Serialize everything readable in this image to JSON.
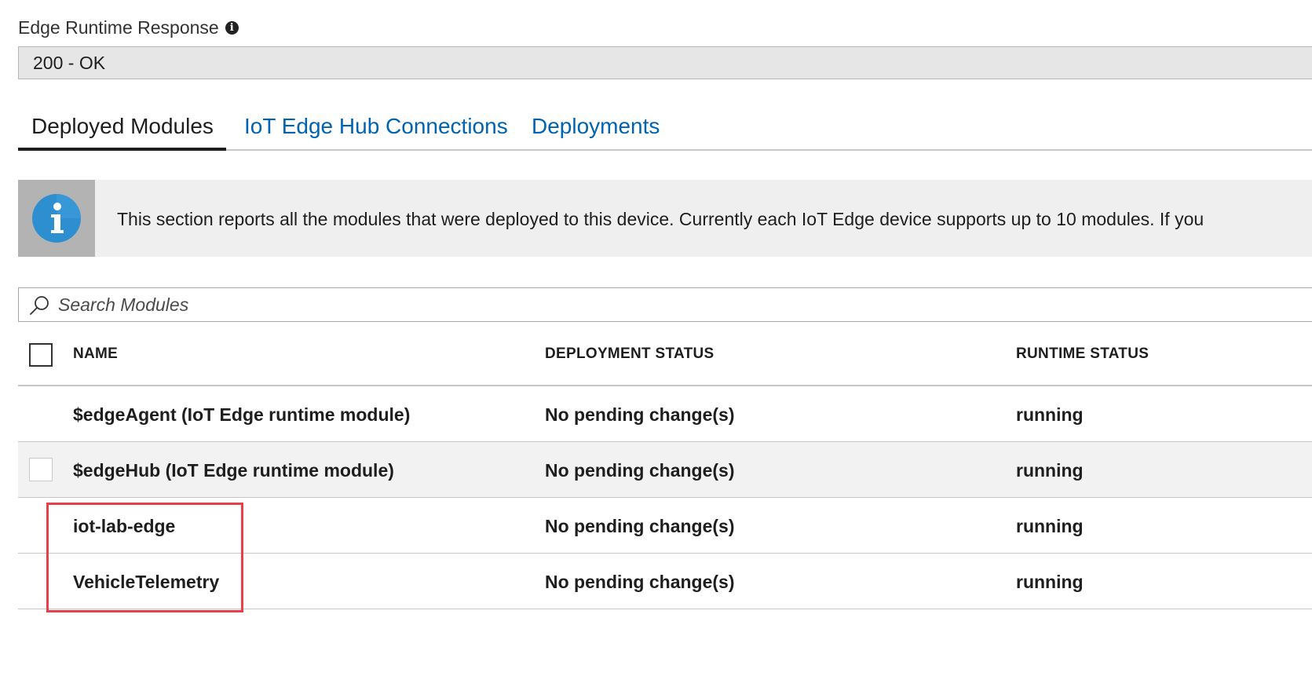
{
  "runtime_response": {
    "label": "Edge Runtime Response",
    "value": "200 - OK"
  },
  "tabs": [
    {
      "label": "Deployed Modules",
      "active": true
    },
    {
      "label": "IoT Edge Hub Connections",
      "active": false
    },
    {
      "label": "Deployments",
      "active": false
    }
  ],
  "info_banner": {
    "text": "This section reports all the modules that were deployed to this device. Currently each IoT Edge device supports up to 10 modules. If you"
  },
  "search": {
    "placeholder": "Search Modules"
  },
  "grid": {
    "columns": {
      "name": "NAME",
      "deployment_status": "DEPLOYMENT STATUS",
      "runtime_status": "RUNTIME STATUS"
    },
    "rows": [
      {
        "name": "$edgeAgent (IoT Edge runtime module)",
        "deployment_status": "No pending change(s)",
        "runtime_status": "running"
      },
      {
        "name": "$edgeHub (IoT Edge runtime module)",
        "deployment_status": "No pending change(s)",
        "runtime_status": "running"
      },
      {
        "name": "iot-lab-edge",
        "deployment_status": "No pending change(s)",
        "runtime_status": "running"
      },
      {
        "name": "VehicleTelemetry",
        "deployment_status": "No pending change(s)",
        "runtime_status": "running"
      }
    ]
  },
  "colors": {
    "link": "#0063b1",
    "highlight": "#e8404a",
    "info_icon": "#2e8fd0"
  },
  "icons": {
    "label_info": "info-circle-icon",
    "banner_info": "info-icon",
    "search": "search-icon"
  }
}
